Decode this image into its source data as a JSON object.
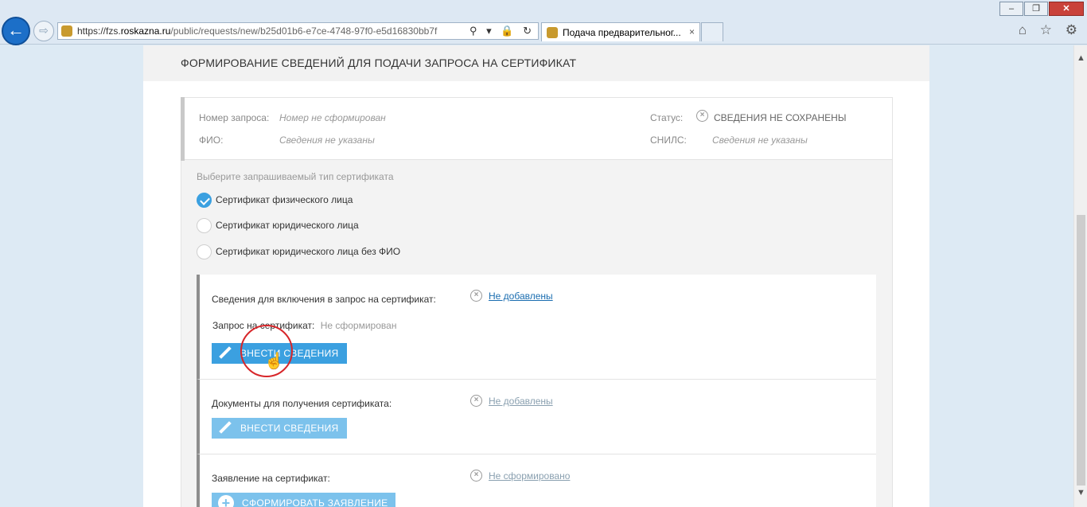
{
  "browser": {
    "url_prefix": "https://fzs.",
    "url_domain": "roskazna.ru",
    "url_path": "/public/requests/new/b25d01b6-e7ce-4748-97f0-e5d16830bb7f",
    "tab_title": "Подача предварительног...",
    "tab_close": "×",
    "back_glyph": "←",
    "forward_glyph": "⇨",
    "address_tools": "⚲ ▾ 🔒 ↻",
    "window_minimize": "–",
    "window_restore": "❐",
    "window_close": "✕",
    "icons": [
      "home-icon",
      "star-icon",
      "gear-icon"
    ],
    "icon_glyphs": "⌂ ☆ ⚙"
  },
  "page": {
    "title": "ФОРМИРОВАНИЕ СВЕДЕНИЙ ДЛЯ ПОДАЧИ ЗАПРОСА НА СЕРТИФИКАТ",
    "info": {
      "request_number_label": "Номер запроса:",
      "request_number_value": "Номер не сформирован",
      "fio_label": "ФИО:",
      "fio_value": "Сведения не указаны",
      "status_label": "Статус:",
      "status_value": "СВЕДЕНИЯ НЕ СОХРАНЕНЫ",
      "snils_label": "СНИЛС:",
      "snils_value": "Сведения не указаны"
    },
    "cert_type": {
      "prompt": "Выберите запрашиваемый тип сертификата",
      "options": [
        {
          "label": "Сертификат физического лица",
          "checked": true
        },
        {
          "label": "Сертификат юридического лица",
          "checked": false
        },
        {
          "label": "Сертификат юридического лица без ФИО",
          "checked": false
        }
      ]
    },
    "sections": [
      {
        "title": "Сведения для включения в запрос на сертификат:",
        "status": "Не добавлены",
        "sub_label": "Запрос на сертификат:",
        "sub_value": "Не сформирован",
        "button": "ВНЕСТИ СВЕДЕНИЯ"
      },
      {
        "title": "Документы для получения сертификата:",
        "status": "Не добавлены",
        "button": "ВНЕСТИ СВЕДЕНИЯ"
      },
      {
        "title": "Заявление на сертификат:",
        "status": "Не сформировано",
        "button": "СФОРМИРОВАТЬ ЗАЯВЛЕНИЕ"
      }
    ]
  },
  "colors": {
    "accent": "#3ba0e0",
    "accent_light": "#7cc2ec",
    "link": "#1a6db0",
    "highlight_ring": "#d7262a"
  }
}
